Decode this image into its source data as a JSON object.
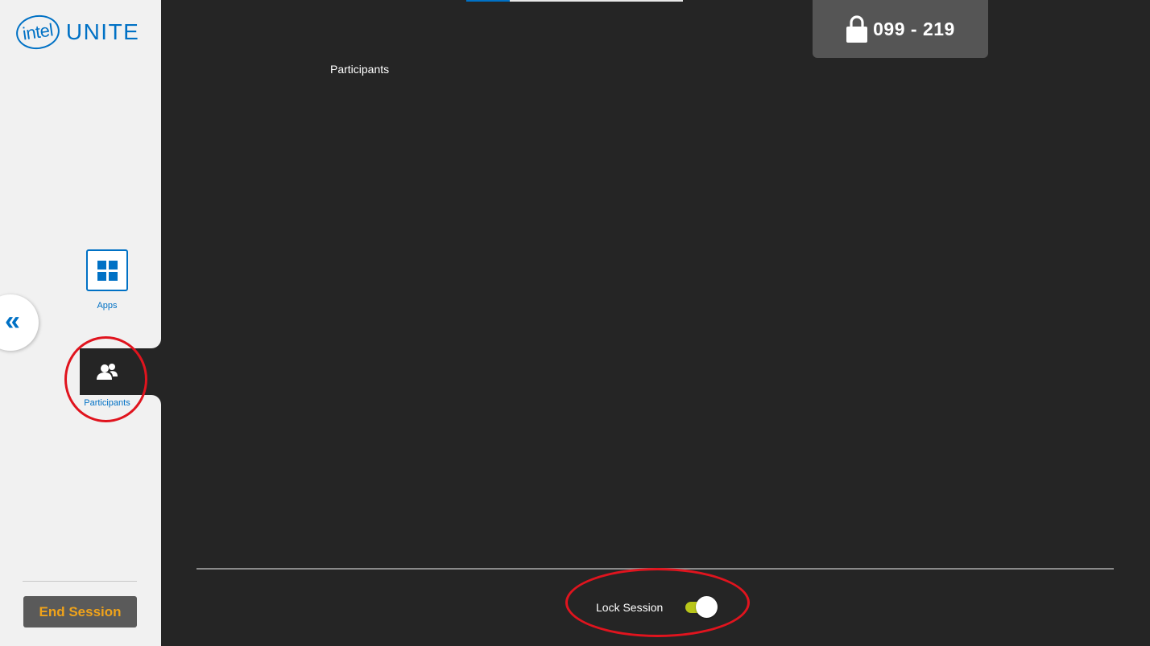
{
  "logo": {
    "mark": "intel",
    "word": "UNITE"
  },
  "sidebar": {
    "items": [
      {
        "label": "Apps",
        "icon": "grid-icon"
      },
      {
        "label": "Participants",
        "icon": "participants-icon"
      }
    ],
    "collapse_glyph": "«",
    "end_session_label": "End Session"
  },
  "pin": {
    "code": "099 - 219",
    "icon": "lock-icon"
  },
  "main": {
    "title": "Participants",
    "progress": 0.2
  },
  "lock_session": {
    "label": "Lock Session",
    "enabled": true
  },
  "colors": {
    "brand_blue": "#0071c5",
    "end_session_text": "#f0a31a",
    "toggle_on": "#b9c61a",
    "annotation_red": "#e0141e"
  }
}
